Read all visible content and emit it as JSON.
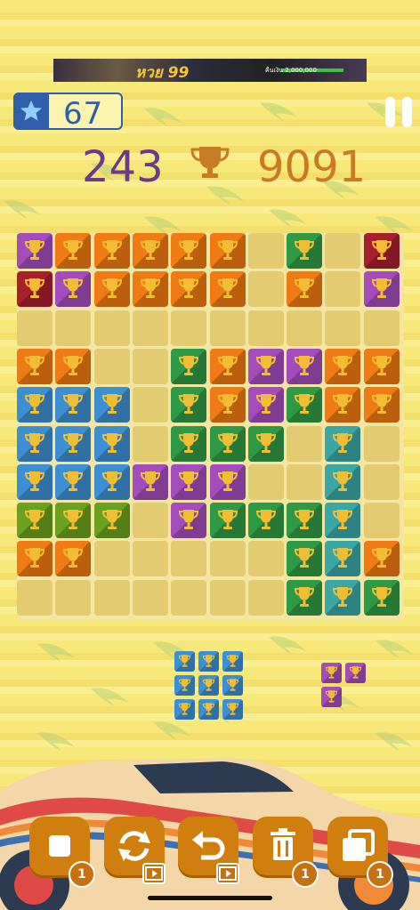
{
  "ad_banner": {
    "headline": "หวย 99",
    "subtext": "คืนเงิน 2,000,000"
  },
  "level": {
    "value": "67",
    "icon": "star-icon"
  },
  "scores": {
    "current": "243",
    "best": "9091",
    "trophy_icon": "trophy-icon"
  },
  "colors": {
    "P": "#a44cbc",
    "R": "#a81f2e",
    "O": "#f07a13",
    "G": "#2f9a45",
    "B": "#3d8fd4",
    "T": "#3aa7a7",
    "L": "#6aa21f",
    "E": "#e2cb70",
    "cup": "#f1bd33",
    "level_blue": "#2f5fa8",
    "score_purple": "#6b3a8a",
    "score_orange": "#c87a24",
    "button_orange": "#d07f0f"
  },
  "board": {
    "size": 10,
    "rows": [
      "POOOOOEGER",
      "RPOOOOEOEP",
      "EEEEEEEEEE",
      "OOEEGOPPOO",
      "BBBEGOPGOO",
      "BBBEGGGETE",
      "BBBPPPEETE",
      "LLLEPGGGTE",
      "OOEEEEEGTO",
      "EEEEEEEGTG"
    ]
  },
  "tray": {
    "piece1": {
      "color": "B",
      "rows": [
        "XXX",
        "XXX",
        "XXX"
      ]
    },
    "piece2": {
      "color": "P",
      "rows": [
        "XX",
        "X."
      ]
    }
  },
  "toolbar": [
    {
      "name": "single-block-button",
      "icon": "square-icon",
      "badge": "1",
      "badge_type": "count"
    },
    {
      "name": "rotate-button",
      "icon": "rotate-icon",
      "badge": "",
      "badge_type": "video"
    },
    {
      "name": "undo-button",
      "icon": "undo-icon",
      "badge": "",
      "badge_type": "video"
    },
    {
      "name": "trash-button",
      "icon": "trash-icon",
      "badge": "1",
      "badge_type": "count"
    },
    {
      "name": "stack-button",
      "icon": "stack-icon",
      "badge": "1",
      "badge_type": "count"
    }
  ]
}
